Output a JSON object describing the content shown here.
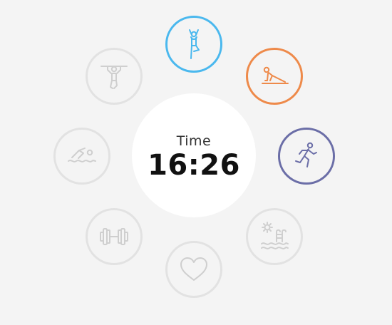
{
  "center": {
    "label": "Time",
    "value": "16:26"
  },
  "activities": [
    {
      "icon": "yoga-tree-pose-icon",
      "color": "#4ab8ee",
      "active": true
    },
    {
      "icon": "plank-exercise-icon",
      "color": "#ee8a4a",
      "active": true
    },
    {
      "icon": "running-icon",
      "color": "#6b6ea7",
      "active": true
    },
    {
      "icon": "pool-sun-icon",
      "color": "#d9d9d9",
      "active": false
    },
    {
      "icon": "heart-icon",
      "color": "#d9d9d9",
      "active": false
    },
    {
      "icon": "dumbbell-icon",
      "color": "#d9d9d9",
      "active": false
    },
    {
      "icon": "swimming-icon",
      "color": "#d9d9d9",
      "active": false
    },
    {
      "icon": "pull-up-bar-icon",
      "color": "#d9d9d9",
      "active": false
    }
  ]
}
